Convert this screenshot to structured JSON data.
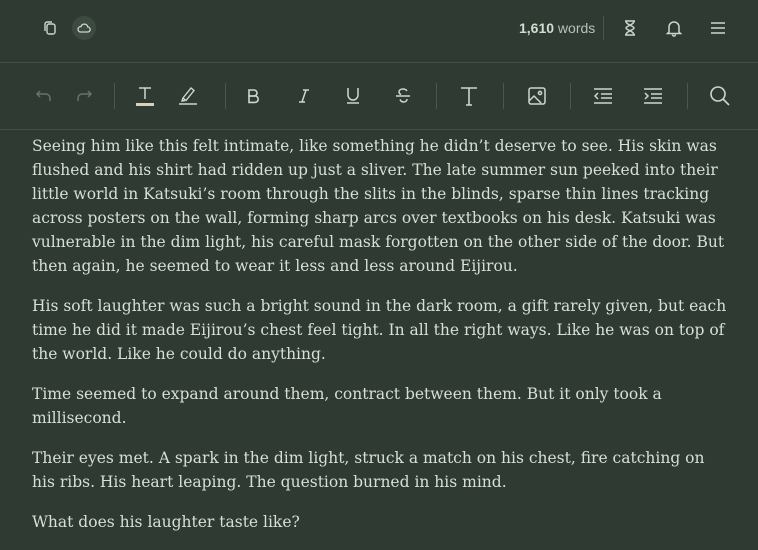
{
  "topbar": {
    "word_count_number": "1,610",
    "word_count_label": " words",
    "icons": [
      "copy-icon",
      "cloud-icon",
      "hourglass-icon",
      "bell-icon",
      "menu-icon"
    ]
  },
  "toolbar": {
    "icons": [
      "undo-icon",
      "redo-icon",
      "text-color-icon",
      "highlight-icon",
      "bold-icon",
      "italic-icon",
      "underline-icon",
      "strikethrough-icon",
      "text-size-icon",
      "image-icon",
      "outdent-icon",
      "indent-icon",
      "search-icon"
    ]
  },
  "document": {
    "paragraphs": [
      "Seeing him like this felt intimate, like something he didn’t deserve to see. His skin was flushed and his shirt had ridden up just a sliver. The late summer sun peeked into their little world in Katsuki’s room through the slits in the blinds, sparse thin lines tracking across posters on the wall, forming sharp arcs over textbooks on his desk. Katsuki was vulnerable in the dim light, his careful mask forgotten on the other side of the door. But then again, he seemed to wear it less and less around Eijirou.",
      "His soft laughter was such a bright sound in the dark room, a gift rarely given, but each time he did it made Eijirou’s chest feel tight. In all the right ways. Like he was on top of the world. Like he could do anything.",
      "Time seemed to expand around them, contract between them. But it only took a millisecond.",
      "Their eyes met. A spark in the dim light, struck a match on his chest, fire catching on his ribs. His heart leaping. The question burned in his mind.",
      "What does his laughter taste like?"
    ]
  },
  "colors": {
    "background": "#2e3a32",
    "text": "#d9dfd5",
    "icon": "#cfd6cc"
  }
}
